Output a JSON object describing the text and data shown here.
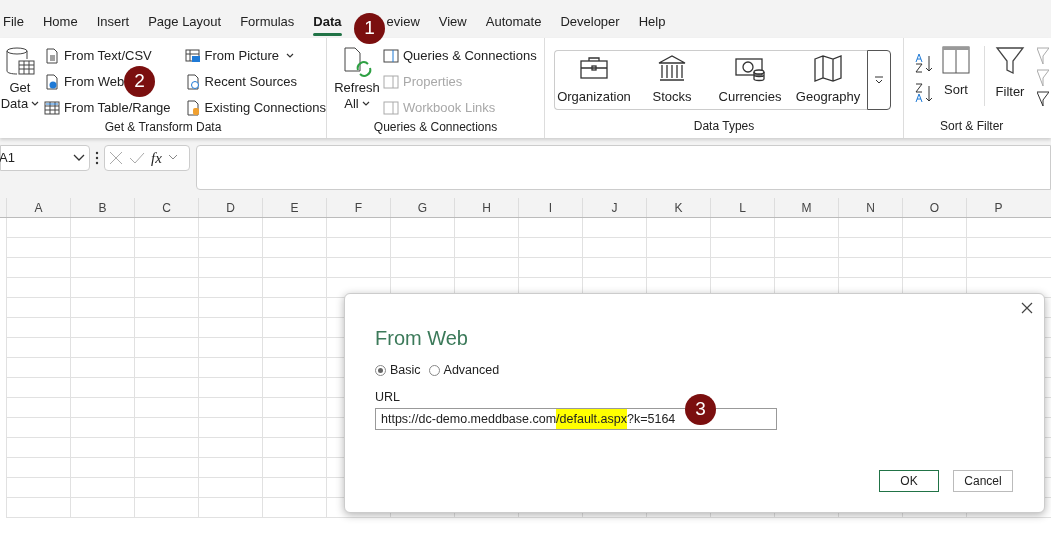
{
  "tabs": [
    {
      "label": "File",
      "selected": false
    },
    {
      "label": "Home",
      "selected": false
    },
    {
      "label": "Insert",
      "selected": false
    },
    {
      "label": "Page Layout",
      "selected": false
    },
    {
      "label": "Formulas",
      "selected": false
    },
    {
      "label": "Data",
      "selected": true
    },
    {
      "label": "eview",
      "selected": false
    },
    {
      "label": "View",
      "selected": false
    },
    {
      "label": "Automate",
      "selected": false
    },
    {
      "label": "Developer",
      "selected": false
    },
    {
      "label": "Help",
      "selected": false
    }
  ],
  "ribbon": {
    "get_transform": {
      "big": {
        "label": "Get",
        "label2": "Data"
      },
      "col1": [
        {
          "label": "From Text/CSV",
          "kind": "text"
        },
        {
          "label": "From Web",
          "kind": "web"
        },
        {
          "label": "From Table/Range",
          "kind": "table"
        }
      ],
      "col2": [
        {
          "label": "From Picture",
          "kind": "picture",
          "dropdown": true
        },
        {
          "label": "Recent Sources",
          "kind": "recent",
          "dropdown": false
        },
        {
          "label": "Existing Connections",
          "kind": "existing",
          "dropdown": false
        }
      ],
      "group_label": "Get & Transform Data"
    },
    "queries": {
      "big": {
        "label": "Refresh",
        "label2": "All"
      },
      "items": [
        {
          "label": "Queries & Connections",
          "disabled": false
        },
        {
          "label": "Properties",
          "disabled": true
        },
        {
          "label": "Workbook Links",
          "disabled": true
        }
      ],
      "group_label": "Queries & Connections"
    },
    "data_types": {
      "items": [
        {
          "label": "Organization",
          "kind": "briefcase"
        },
        {
          "label": "Stocks",
          "kind": "bank"
        },
        {
          "label": "Currencies",
          "kind": "money"
        },
        {
          "label": "Geography",
          "kind": "map"
        }
      ],
      "group_label": "Data Types"
    },
    "sort_filter": {
      "sort": "Sort",
      "filter": "Filter",
      "group_label": "Sort & Filter"
    }
  },
  "name_box": "A1",
  "formula_icons": {
    "fx": "fx"
  },
  "columns": [
    "A",
    "B",
    "C",
    "D",
    "E",
    "F",
    "G",
    "H",
    "I",
    "J",
    "K",
    "L",
    "M",
    "N",
    "O",
    "P"
  ],
  "dialog": {
    "title": "From Web",
    "radios": [
      {
        "label": "Basic",
        "selected": true
      },
      {
        "label": "Advanced",
        "selected": false
      }
    ],
    "url_label": "URL",
    "url_parts": [
      {
        "text": "https://dc-demo.meddbase.com",
        "highlighted": false
      },
      {
        "text": "/default.aspx",
        "highlighted": true
      },
      {
        "text": "?k=5164",
        "highlighted": false
      }
    ],
    "buttons": [
      {
        "label": "OK",
        "primary": true
      },
      {
        "label": "Cancel",
        "primary": false
      }
    ]
  },
  "callouts": [
    "1",
    "2",
    "3"
  ]
}
